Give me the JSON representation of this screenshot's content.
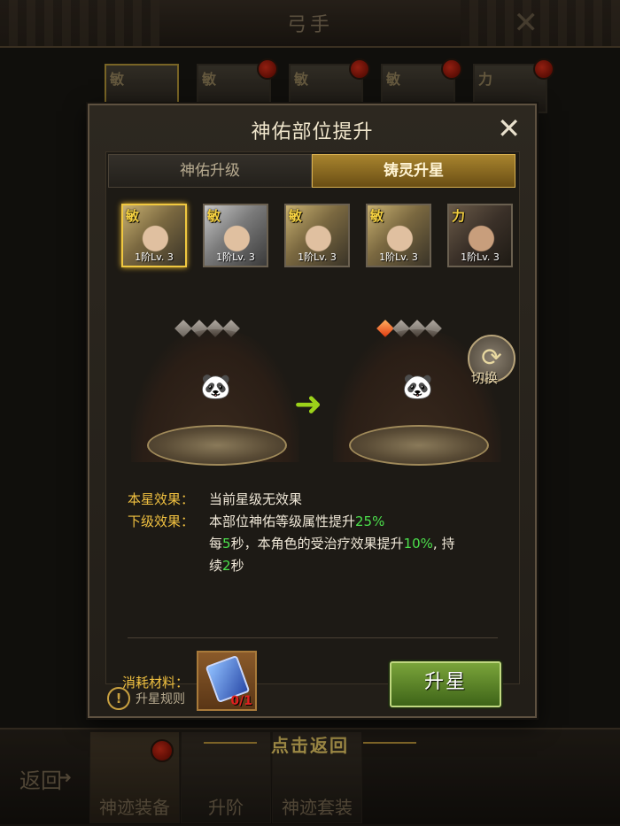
{
  "background": {
    "title": "弓手",
    "close": "✕",
    "portraits": [
      {
        "attr": "敏",
        "selected": true,
        "dot": false
      },
      {
        "attr": "敏",
        "selected": false,
        "dot": true
      },
      {
        "attr": "敏",
        "selected": false,
        "dot": true
      },
      {
        "attr": "敏",
        "selected": false,
        "dot": true
      },
      {
        "attr": "力",
        "selected": false,
        "dot": true
      }
    ],
    "back_label": "返回",
    "click_return": "点击返回",
    "bottom_tabs": [
      {
        "label": "神迹装备",
        "active": true,
        "dot": true
      },
      {
        "label": "升阶",
        "active": false,
        "dot": false
      },
      {
        "label": "神迹套装",
        "active": false,
        "dot": false
      }
    ]
  },
  "dialog": {
    "title": "神佑部位提升",
    "close_icon": "✕",
    "tabs": [
      {
        "label": "神佑升级",
        "active": false
      },
      {
        "label": "铸灵升星",
        "active": true
      }
    ],
    "heroes": [
      {
        "attr": "敏",
        "level": "1阶Lv. 3",
        "selected": true,
        "tone": "gold"
      },
      {
        "attr": "敏",
        "level": "1阶Lv. 3",
        "selected": false,
        "tone": "silver"
      },
      {
        "attr": "敏",
        "level": "1阶Lv. 3",
        "selected": false,
        "tone": "gold"
      },
      {
        "attr": "敏",
        "level": "1阶Lv. 3",
        "selected": false,
        "tone": "gold"
      },
      {
        "attr": "力",
        "level": "1阶Lv. 3",
        "selected": false,
        "tone": "dark"
      }
    ],
    "current_stars": {
      "lit": 0,
      "total": 4
    },
    "next_stars": {
      "lit": 1,
      "total": 4
    },
    "switch_label": "切换",
    "effects": {
      "current_key": "本星效果：",
      "current_val": "当前星级无效果",
      "next_key": "下级效果：",
      "next_line1_prefix": "本部位神佑等级属性提升",
      "next_line1_value": "25%",
      "next_line2_a": "每",
      "next_line2_b": "5",
      "next_line2_c": "秒，本角色的受治疗效果提升",
      "next_line2_d": "10%",
      "next_line2_e": ", 持",
      "next_line3_a": "续",
      "next_line3_b": "2",
      "next_line3_c": "秒"
    },
    "cost_label": "消耗材料：",
    "material_count": "0/1",
    "upgrade_label": "升星",
    "rules_label": "升星规则",
    "colors": {
      "accent": "#f0c040",
      "highlight": "#4ce04c",
      "button": "#5a8a28"
    }
  }
}
